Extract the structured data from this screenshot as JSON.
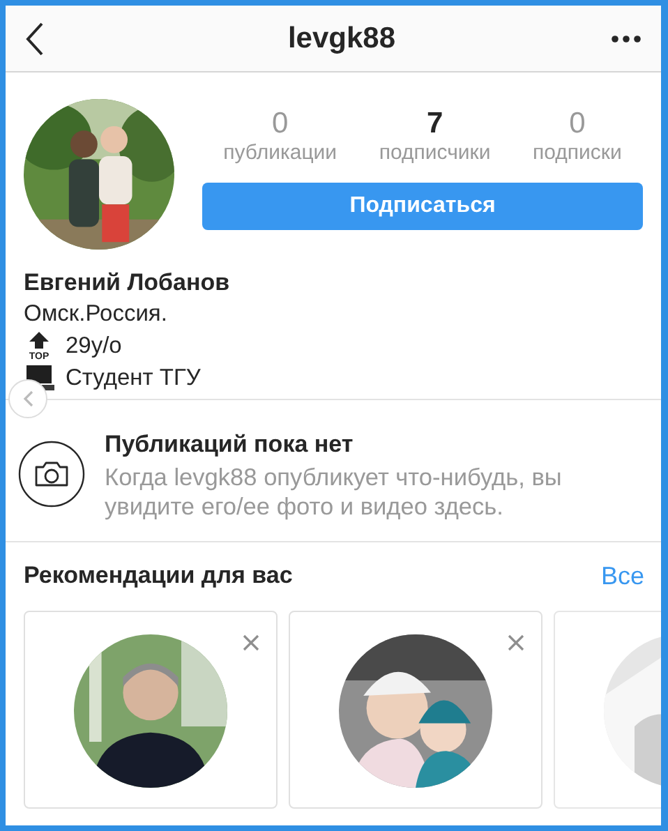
{
  "header": {
    "title": "levgk88"
  },
  "profile": {
    "avatar": {
      "kind": "picture"
    },
    "stats": [
      {
        "count": "0",
        "label": "публикации",
        "muted": true
      },
      {
        "count": "7",
        "label": "подписчики",
        "muted": false
      },
      {
        "count": "0",
        "label": "подписки",
        "muted": true
      }
    ],
    "follow_button": "Подписаться",
    "name": "Евгений Лобанов",
    "bio": [
      {
        "kind": "plain",
        "text": "Омск.Россия."
      },
      {
        "kind": "top",
        "icon_label": "TOP",
        "text": "29y/o"
      },
      {
        "kind": "laptop",
        "text": "Студент ТГУ"
      }
    ]
  },
  "empty_posts": {
    "title": "Публикаций пока нет",
    "text": "Когда levgk88 опубликует что-нибудь, вы увидите его/ее фото и видео здесь."
  },
  "recommendations": {
    "title": "Рекомендации для вас",
    "see_all": "Все",
    "cards": [
      {
        "kind": "picture",
        "close_button": true
      },
      {
        "kind": "picture",
        "close_button": true
      },
      {
        "kind": "picture"
      }
    ]
  }
}
